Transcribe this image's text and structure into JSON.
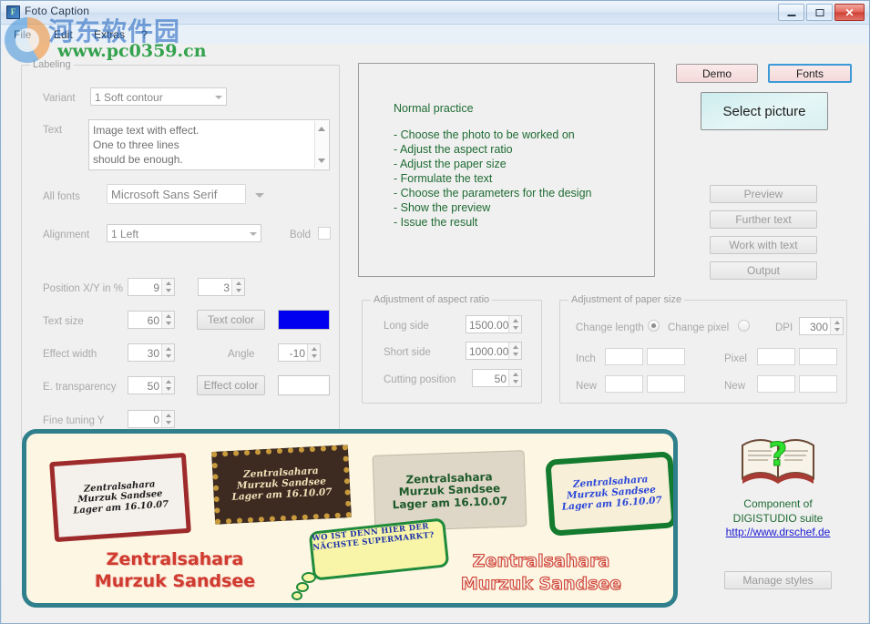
{
  "window": {
    "title": "Foto Caption",
    "icon": "app-icon",
    "buttons": {
      "minimize": "–",
      "maximize": "□",
      "close": "✕"
    }
  },
  "menu": {
    "items": [
      "File",
      "Edit",
      "Extras",
      "?"
    ]
  },
  "watermark": {
    "cjk": "河东软件园",
    "url": "www.pc0359.cn"
  },
  "labeling": {
    "title": "Labeling",
    "variant_label": "Variant",
    "variant_value": "1 Soft contour",
    "text_label": "Text",
    "text_value": "Image text with effect.\nOne to three lines\nshould be enough.",
    "fonts_label": "All fonts",
    "fonts_value": "Microsoft Sans Serif",
    "alignment_label": "Alignment",
    "alignment_value": "1 Left",
    "bold_label": "Bold",
    "position_label": "Position X/Y in %",
    "position_x": "9",
    "position_y": "3",
    "text_size_label": "Text size",
    "text_size_value": "60",
    "text_color_label": "Text color",
    "text_color_value": "#0000F0",
    "effect_width_label": "Effect width",
    "effect_width_value": "30",
    "angle_label": "Angle",
    "angle_value": "-10",
    "transparency_label": "E. transparency",
    "transparency_value": "50",
    "effect_color_label": "Effect color",
    "effect_color_value": "#FFFFFF",
    "fine_tuning_label": "Fine tuning Y",
    "fine_tuning_value": "0"
  },
  "instructions": {
    "title": "Normal practice",
    "steps": [
      "- Choose the photo to be worked on",
      "- Adjust the aspect ratio",
      "- Adjust the paper size",
      "- Formulate the text",
      "- Choose the parameters for the design",
      "- Show the preview",
      "- Issue the result"
    ]
  },
  "aspect": {
    "title": "Adjustment of aspect ratio",
    "long_side_label": "Long side",
    "long_side_value": "1500.00",
    "short_side_label": "Short side",
    "short_side_value": "1000.00",
    "cutting_label": "Cutting position",
    "cutting_value": "50"
  },
  "paper": {
    "title": "Adjustment of paper size",
    "change_length_label": "Change length",
    "change_pixel_label": "Change pixel",
    "dpi_label": "DPI",
    "dpi_value": "300",
    "inch_label": "Inch",
    "inch_new_label": "New",
    "pixel_label": "Pixel",
    "pixel_new_label": "New",
    "inch_w": "",
    "inch_h": "",
    "inch_new_w": "",
    "inch_new_h": "",
    "pixel_w": "",
    "pixel_h": "",
    "pixel_new_w": "",
    "pixel_new_h": ""
  },
  "actions": {
    "demo": "Demo",
    "fonts": "Fonts",
    "select_picture": "Select picture",
    "preview": "Preview",
    "further_text": "Further text",
    "work_with_text": "Work with text",
    "output": "Output",
    "manage_styles": "Manage styles"
  },
  "gallery": {
    "cards": [
      {
        "lines": [
          "Zentralsahara",
          "Murzuk Sandsee",
          "Lager am 16.10.07"
        ]
      },
      {
        "lines": [
          "Zentralsahara",
          "Murzuk Sandsee",
          "Lager am 16.10.07"
        ]
      },
      {
        "lines": [
          "Zentralsahara",
          "Murzuk Sandsee",
          "Lager am 16.10.07"
        ]
      },
      {
        "lines": [
          "Zentralsahara",
          "Murzuk Sandsee",
          "Lager am 16.10.07"
        ]
      }
    ],
    "bubble": {
      "lines": [
        "Wo ist denn hier der",
        "nächste Supermarkt?"
      ]
    },
    "big_red": {
      "line1": "Zentralsahara",
      "line2": "Murzuk Sandsee"
    },
    "big_outline": {
      "line1": "Zentralsahara",
      "line2": "Murzuk Sandsee"
    }
  },
  "info": {
    "line1": "Component of",
    "line2": "DIGISTUDIO suite",
    "link": "http://www.drschef.de",
    "icon": "book-question-icon"
  },
  "colors": {
    "accent_teal": "#2F7F8C",
    "link_blue": "#1A1AD0",
    "green_text": "#1F6B33",
    "demo_pink": "#F7E3E3",
    "select_cyan": "#D7F0F1"
  }
}
